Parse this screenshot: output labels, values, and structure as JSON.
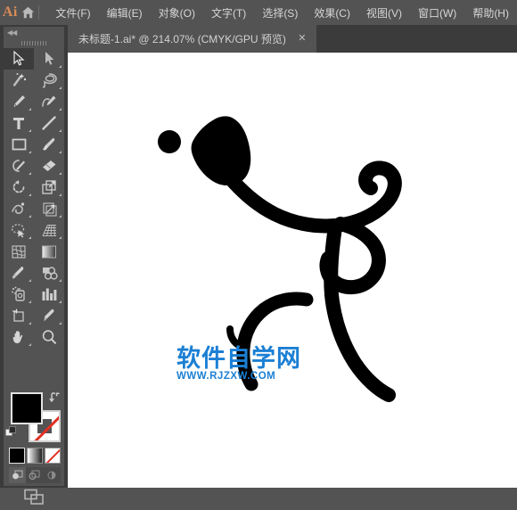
{
  "app": {
    "logo_text": "Ai",
    "home_icon": "home-icon"
  },
  "menubar": {
    "items": [
      {
        "label": "文件(F)",
        "name": "menu-file"
      },
      {
        "label": "编辑(E)",
        "name": "menu-edit"
      },
      {
        "label": "对象(O)",
        "name": "menu-object"
      },
      {
        "label": "文字(T)",
        "name": "menu-type"
      },
      {
        "label": "选择(S)",
        "name": "menu-select"
      },
      {
        "label": "效果(C)",
        "name": "menu-effect"
      },
      {
        "label": "视图(V)",
        "name": "menu-view"
      },
      {
        "label": "窗口(W)",
        "name": "menu-window"
      },
      {
        "label": "帮助(H)",
        "name": "menu-help"
      }
    ]
  },
  "tabbar": {
    "tab": {
      "title": "未标题-1.ai* @ 214.07% (CMYK/GPU 预览)",
      "close_label": "✕",
      "document_name": "未标题-1.ai*",
      "zoom_level": "214.07%",
      "color_mode": "CMYK/GPU 预览"
    }
  },
  "toolpanel": {
    "collapse_label": "◀◀",
    "tools": [
      {
        "label": "选择工具",
        "name": "tool-selection",
        "active": true
      },
      {
        "label": "直接选择工具",
        "name": "tool-direct-selection",
        "active": false
      },
      {
        "label": "魔棒工具",
        "name": "tool-magic-wand",
        "active": false
      },
      {
        "label": "套索工具",
        "name": "tool-lasso",
        "active": false
      },
      {
        "label": "钢笔工具",
        "name": "tool-pen",
        "active": false
      },
      {
        "label": "曲率工具",
        "name": "tool-curvature",
        "active": false
      },
      {
        "label": "文字工具",
        "name": "tool-type",
        "active": false
      },
      {
        "label": "直线段工具",
        "name": "tool-line-segment",
        "active": false
      },
      {
        "label": "矩形工具",
        "name": "tool-rectangle",
        "active": false
      },
      {
        "label": "画笔工具",
        "name": "tool-paintbrush",
        "active": false
      },
      {
        "label": "Shaper 工具",
        "name": "tool-shaper",
        "active": false
      },
      {
        "label": "橡皮擦工具",
        "name": "tool-eraser",
        "active": false
      },
      {
        "label": "旋转工具",
        "name": "tool-rotate",
        "active": false
      },
      {
        "label": "比例缩放工具",
        "name": "tool-scale",
        "active": false
      },
      {
        "label": "宽度工具",
        "name": "tool-width",
        "active": false
      },
      {
        "label": "自由变换工具",
        "name": "tool-free-transform",
        "active": false
      },
      {
        "label": "形状生成器工具",
        "name": "tool-shape-builder",
        "active": false
      },
      {
        "label": "透视网格工具",
        "name": "tool-perspective-grid",
        "active": false
      },
      {
        "label": "网格工具",
        "name": "tool-mesh",
        "active": false
      },
      {
        "label": "渐变工具",
        "name": "tool-gradient",
        "active": false
      },
      {
        "label": "吸管工具",
        "name": "tool-eyedropper",
        "active": false
      },
      {
        "label": "混合工具",
        "name": "tool-blend",
        "active": false
      },
      {
        "label": "符号喷枪工具",
        "name": "tool-symbol-sprayer",
        "active": false
      },
      {
        "label": "柱形图工具",
        "name": "tool-column-graph",
        "active": false
      },
      {
        "label": "画板工具",
        "name": "tool-artboard",
        "active": false
      },
      {
        "label": "切片工具",
        "name": "tool-slice",
        "active": false
      },
      {
        "label": "抓手工具",
        "name": "tool-hand",
        "active": false
      },
      {
        "label": "缩放工具",
        "name": "tool-zoom",
        "active": false
      }
    ],
    "swatches": {
      "fill_color": "#000000",
      "fill_label": "填色",
      "stroke_label": "描边",
      "stroke_color": "none",
      "swap_label": "互换填色和描边",
      "default_label": "默认填色和描边",
      "buttons": [
        {
          "label": "颜色",
          "name": "swatch-color",
          "selected": true
        },
        {
          "label": "渐变",
          "name": "swatch-gradient",
          "selected": false
        },
        {
          "label": "无",
          "name": "swatch-none",
          "selected": false
        }
      ],
      "draw_modes": [
        {
          "label": "正常绘图",
          "name": "draw-mode-normal",
          "active": true
        },
        {
          "label": "背面绘图",
          "name": "draw-mode-behind",
          "active": false
        },
        {
          "label": "内部绘图",
          "name": "draw-mode-inside",
          "active": false
        }
      ],
      "screen_mode_label": "更改屏幕模式"
    }
  },
  "canvas": {
    "background": "#ffffff",
    "artwork_label": "黑色书法笔触图形",
    "artwork_color": "#000000"
  },
  "watermark": {
    "chinese": "软件自学网",
    "url": "WWW.RJZXW.COM",
    "color": "#1b7fd4"
  }
}
